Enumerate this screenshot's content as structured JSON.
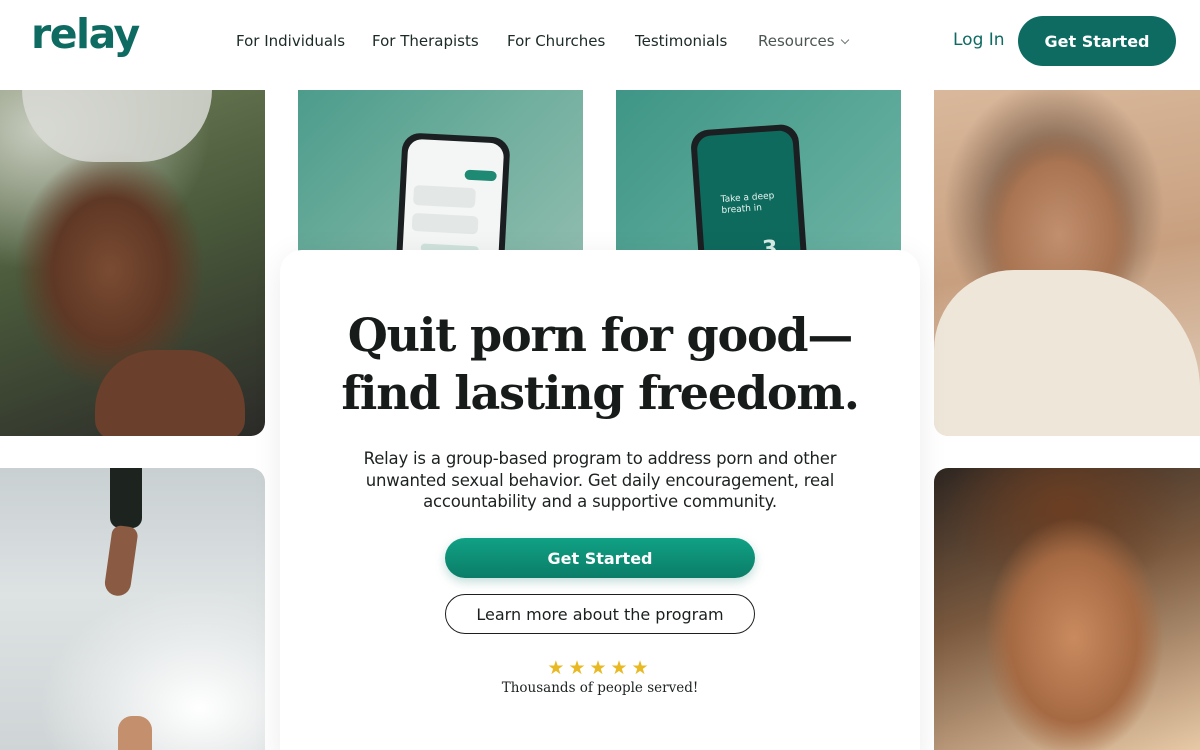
{
  "header": {
    "logo": "relay",
    "nav": [
      "For Individuals",
      "For Therapists",
      "For Churches",
      "Testimonials"
    ],
    "resources_label": "Resources",
    "login_label": "Log In",
    "cta_label": "Get Started"
  },
  "collage": {
    "phone2_text": "Take a deep breath in",
    "phone2_count": "3"
  },
  "hero": {
    "headline_line1": "Quit porn for good—",
    "headline_line2": "find lasting freedom.",
    "subtext": "Relay is a group-based program to address porn and other unwanted sexual behavior. Get daily encouragement, real accountability and a supportive community.",
    "primary_cta": "Get Started",
    "secondary_cta": "Learn more about the program",
    "rating_stars": "★★★★★",
    "rating_caption": "Thousands of people served!"
  },
  "colors": {
    "brand": "#0e6b62",
    "cta_gradient_top": "#10a184",
    "star": "#e8b923"
  },
  "icons": {
    "resources_dropdown": "chevron-down-icon",
    "rating": "star-icon"
  }
}
